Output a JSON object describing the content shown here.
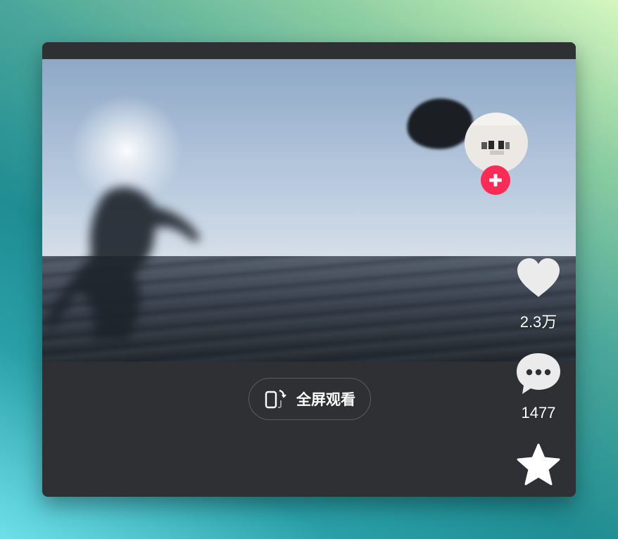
{
  "video": {
    "description_hidden": ""
  },
  "fullscreen_button": {
    "label": "全屏观看"
  },
  "actions": {
    "like_count": "2.3万",
    "comment_count": "1477"
  },
  "icons": {
    "avatar": "avatar",
    "follow": "plus-icon",
    "like": "heart-icon",
    "comment": "comment-icon",
    "favorite": "star-icon",
    "rotate": "rotate-phone-icon"
  },
  "colors": {
    "follow_badge": "#fe2c55",
    "panel": "#2e3033"
  }
}
